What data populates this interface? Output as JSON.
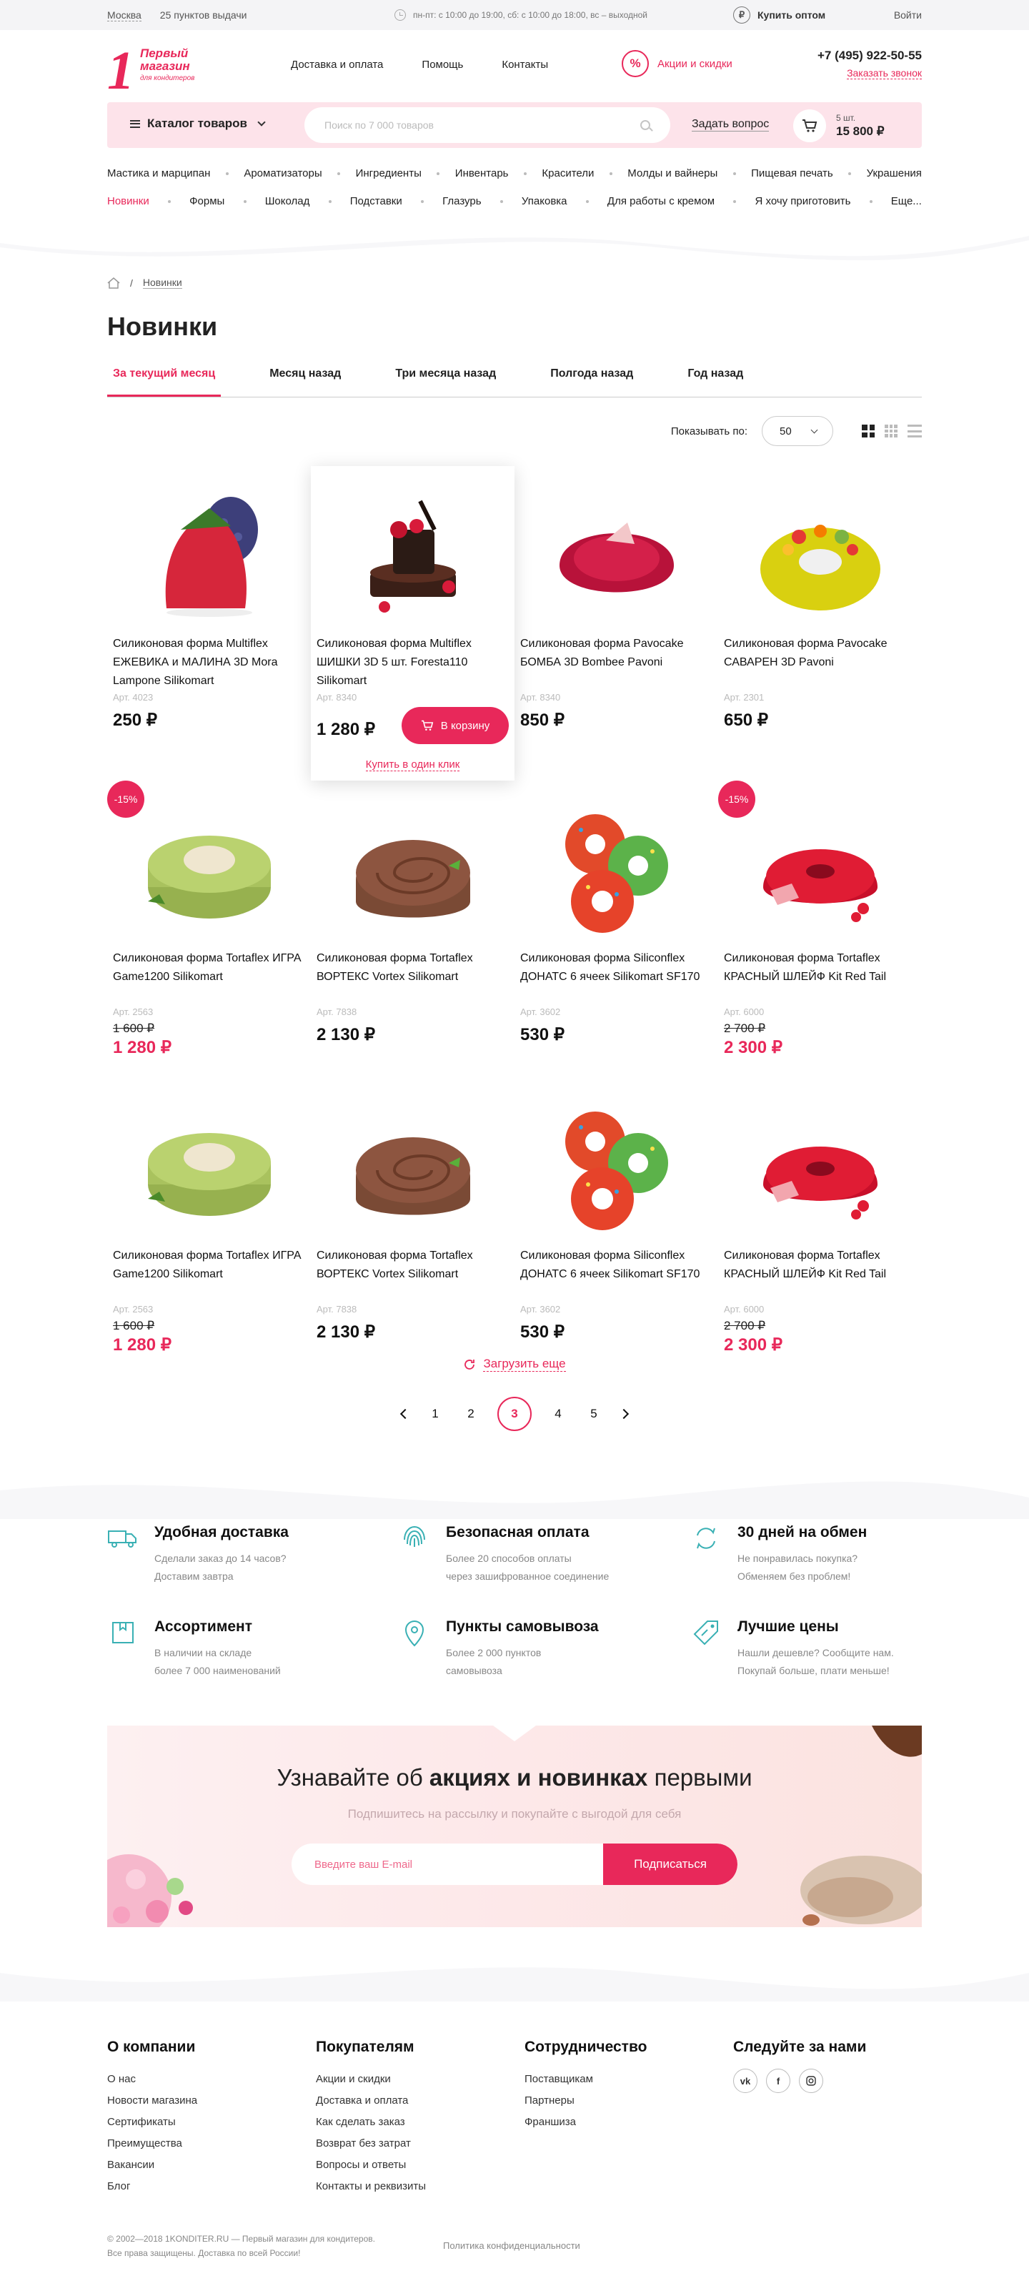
{
  "topbar": {
    "city": "Москва",
    "pickup": "25 пунктов выдачи",
    "hours": "пн-пт: с 10:00 до 19:00, сб: с 10:00 до 18:00, вс – выходной",
    "wholesale": "Купить оптом",
    "login": "Войти"
  },
  "header": {
    "logo_lines": [
      "Первый",
      "магазин",
      "для кондитеров"
    ],
    "logo_digit": "1",
    "nav": [
      "Доставка и оплата",
      "Помощь",
      "Контакты"
    ],
    "promo": "Акции и скидки",
    "promo_symbol": "%",
    "phone": "+7 (495) 922-50-55",
    "callback": "Заказать звонок"
  },
  "searchbar": {
    "catalog": "Каталог товаров",
    "placeholder": "Поиск по 7 000 товаров",
    "ask": "Задать вопрос",
    "cart_count": "5 шт.",
    "cart_sum": "15 800 ₽"
  },
  "cats_row1": [
    "Мастика и марципан",
    "Ароматизаторы",
    "Ингредиенты",
    "Инвентарь",
    "Красители",
    "Молды и вайнеры",
    "Пищевая печать",
    "Украшения"
  ],
  "cats_row2": [
    "Новинки",
    "Формы",
    "Шоколад",
    "Подставки",
    "Глазурь",
    "Упаковка",
    "Для работы с кремом",
    "Я хочу приготовить",
    "Еще..."
  ],
  "breadcrumb": {
    "current": "Новинки"
  },
  "page_title": "Новинки",
  "tabs": [
    "За текущий месяц",
    "Месяц назад",
    "Три месяца назад",
    "Полгода назад",
    "Год назад"
  ],
  "show": {
    "label": "Показывать по:",
    "value": "50"
  },
  "products": [
    {
      "title": "Силиконовая форма Multiflex ЕЖЕВИКА и МАЛИНА 3D Mora Lampone Silikomart",
      "art": "Арт. 4023",
      "price": "250 ₽",
      "img": "berries"
    },
    {
      "title": "Силиконовая форма Multiflex ШИШКИ 3D 5 шт. Foresta110 Silikomart",
      "art": "Арт. 8340",
      "price": "1 280 ₽",
      "img": "cake",
      "hover": true,
      "buy": "В корзину",
      "oneclick": "Купить в один клик"
    },
    {
      "title": "Силиконовая форма Pavocake БОМБА 3D Bombee Pavoni",
      "art": "Арт. 8340",
      "price": "850 ₽",
      "img": "redcake"
    },
    {
      "title": "Силиконовая форма Pavocake САВАРЕН 3D Pavoni",
      "art": "Арт. 2301",
      "price": "650 ₽",
      "img": "yellowring"
    },
    {
      "title": "Силиконовая форма Tortaflex ИГРА Game1200 Silikomart",
      "art": "Арт. 2563",
      "old": "1 600 ₽",
      "newp": "1 280 ₽",
      "disc": "-15%",
      "img": "green"
    },
    {
      "title": "Силиконовая форма Tortaflex ВОРТЕКС Vortex Silikomart",
      "art": "Арт. 7838",
      "price": "2 130 ₽",
      "img": "vortex"
    },
    {
      "title": "Силиконовая форма Siliconflex ДОНАТС 6 ячеек Silikomart SF170",
      "art": "Арт. 3602",
      "price": "530 ₽",
      "img": "donuts"
    },
    {
      "title": "Силиконовая форма Tortaflex КРАСНЫЙ ШЛЕЙФ Kit Red Tail",
      "art": "Арт. 6000",
      "old": "2 700 ₽",
      "newp": "2 300 ₽",
      "disc": "-15%",
      "img": "redtail"
    },
    {
      "title": "Силиконовая форма Tortaflex ИГРА Game1200 Silikomart",
      "art": "Арт. 2563",
      "old": "1 600 ₽",
      "newp": "1 280 ₽",
      "img": "green"
    },
    {
      "title": "Силиконовая форма Tortaflex ВОРТЕКС Vortex Silikomart",
      "art": "Арт. 7838",
      "price": "2 130 ₽",
      "img": "vortex"
    },
    {
      "title": "Силиконовая форма Siliconflex ДОНАТС 6 ячеек Silikomart SF170",
      "art": "Арт. 3602",
      "price": "530 ₽",
      "img": "donuts"
    },
    {
      "title": "Силиконовая форма Tortaflex КРАСНЫЙ ШЛЕЙФ Kit Red Tail",
      "art": "Арт. 6000",
      "old": "2 700 ₽",
      "newp": "2 300 ₽",
      "img": "redtail"
    }
  ],
  "load_more": "Загрузить еще",
  "pager": {
    "pages": [
      "1",
      "2",
      "3",
      "4",
      "5"
    ],
    "current": "3"
  },
  "features": [
    {
      "title": "Удобная доставка",
      "text": "Сделали заказ до 14 часов?\nДоставим завтра",
      "icon": "truck-icon"
    },
    {
      "title": "Безопасная оплата",
      "text": "Более 20 способов оплаты\nчерез зашифрованное соединение",
      "icon": "fingerprint-icon"
    },
    {
      "title": "30 дней на обмен",
      "text": "Не понравилась покупка?\nОбменяем без проблем!",
      "icon": "exchange-icon"
    },
    {
      "title": "Ассортимент",
      "text": "В наличии на складе\nболее 7 000 наименований",
      "icon": "box-icon"
    },
    {
      "title": "Пункты самовывоза",
      "text": "Более 2 000 пунктов\nсамовывоза",
      "icon": "pin-icon"
    },
    {
      "title": "Лучшие цены",
      "text": "Нашли дешевле? Сообщите нам.\nПокупай больше, плати меньше!",
      "icon": "tag-icon"
    }
  ],
  "subscribe": {
    "title_pre": "Узнавайте об ",
    "title_bold": "акциях и новинках",
    "title_post": " первыми",
    "subtitle": "Подпишитесь на рассылку и покупайте с выгодой для себя",
    "placeholder": "Введите ваш E-mail",
    "button": "Подписаться"
  },
  "footer": {
    "cols": [
      {
        "title": "О компании",
        "items": [
          "О нас",
          "Новости магазина",
          "Сертификаты",
          "Преимущества",
          "Вакансии",
          "Блог"
        ]
      },
      {
        "title": "Покупателям",
        "items": [
          "Акции и скидки",
          "Доставка и оплата",
          "Как сделать заказ",
          "Возврат без затрат",
          "Вопросы и ответы",
          "Контакты и реквизиты"
        ]
      },
      {
        "title": "Сотрудничество",
        "items": [
          "Поставщикам",
          "Партнеры",
          "Франшиза"
        ]
      },
      {
        "title": "Следуйте за нами",
        "items": []
      }
    ],
    "social": [
      "vk",
      "f",
      "ig"
    ],
    "copy1": "© 2002—2018 1KONDITER.RU — Первый магазин для кондитеров.",
    "copy2": "Все права защищены. Доставка по всей России!",
    "policy": "Политика конфиденциальности"
  },
  "colors": {
    "accent": "#e8285a",
    "pink_bg": "#fde3ea"
  }
}
